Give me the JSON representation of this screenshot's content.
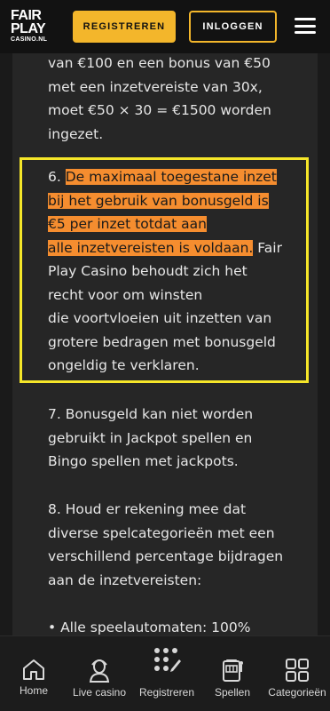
{
  "header": {
    "logo": {
      "line1": "FAIR",
      "line2": "PLAY",
      "line3": "CASINO.NL"
    },
    "register_label": "REGISTREREN",
    "login_label": "INLOGGEN"
  },
  "content": {
    "top_lines": [
      "van €100 en een bonus van €50",
      "met een inzetvereiste van 30x,",
      "moet €50 × 30 = €1500 worden",
      "ingezet."
    ],
    "para6": {
      "number": "6.",
      "highlight_lines": [
        "De maximaal toegestane inzet",
        "bij het gebruik van bonusgeld is",
        "€5 per inzet totdat aan",
        "alle inzetvereisten is voldaan."
      ],
      "rest_first": " Fair",
      "rest_lines": [
        "Play Casino behoudt zich het",
        "recht voor om winsten",
        "die voortvloeien uit inzetten van",
        "grotere bedragen met bonusgeld",
        "ongeldig te verklaren."
      ]
    },
    "para7_lines": [
      "7. Bonusgeld kan niet worden",
      "gebruikt in Jackpot spellen en",
      "Bingo spellen met jackpots."
    ],
    "para8_lines": [
      "8. Houd er rekening mee dat",
      "diverse spelcategorieën met een",
      "verschillend percentage bijdragen",
      "aan de inzetvereisten:"
    ],
    "bullet": "• Alle speelautomaten: 100%"
  },
  "nav": {
    "home": "Home",
    "live_casino": "Live casino",
    "register": "Registreren",
    "games": "Spellen",
    "categories": "Categorieën"
  },
  "colors": {
    "accent": "#f3b62b",
    "highlight": "#f58d2f",
    "box_border": "#f5e629"
  }
}
